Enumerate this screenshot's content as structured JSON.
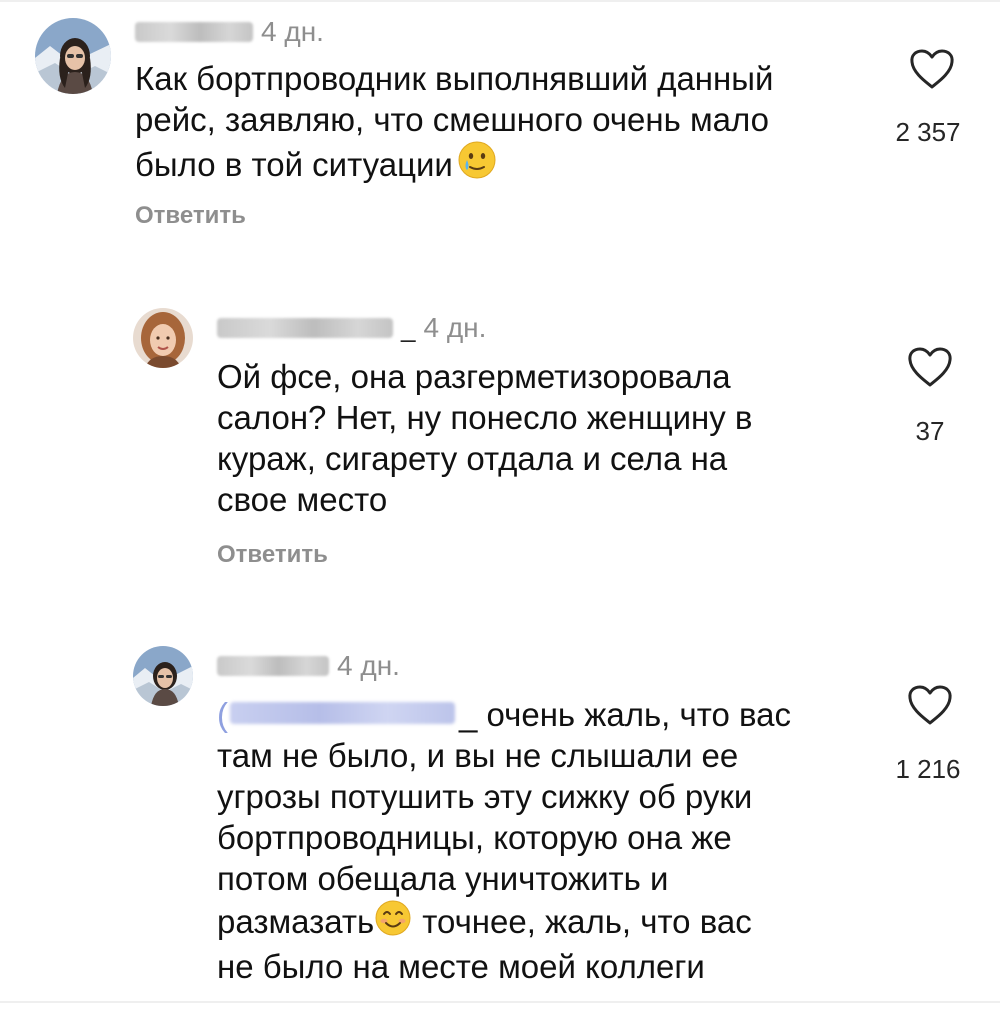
{
  "comments": [
    {
      "username_suffix": "",
      "time": "4 дн.",
      "lines": [
        "Как бортпроводник выполнявший данный",
        "рейс, заявляю, что смешного очень мало",
        "было в той ситуации"
      ],
      "emoji_icon": "tearful-smile-emoji",
      "reply_label": "Ответить",
      "likes": "2 357"
    },
    {
      "username_suffix": "_",
      "time": "4 дн.",
      "lines": [
        "Ой фсе, она разгерметизоровала",
        "салон? Нет, ну понесло женщину в",
        "кураж, сигарету отдала и села на",
        "свое место"
      ],
      "reply_label": "Ответить",
      "likes": "37"
    },
    {
      "username_suffix": "",
      "time": "4 дн.",
      "mention_open": "(",
      "mention_tail": "_",
      "first_line_rest": "очень жаль, что вас",
      "lines": [
        "там не было, и вы не слышали ее",
        "угрозы потушить эту сижку об руки",
        "бортпроводницы, которую она же",
        "потом обещала уничтожить и"
      ],
      "line_before_emoji": "размазать",
      "emoji_icon": "smiling-face-emoji",
      "line_after_emoji": "точнее, жаль, что вас",
      "last_line": "не было на месте моей коллеги",
      "likes": "1 216"
    }
  ]
}
